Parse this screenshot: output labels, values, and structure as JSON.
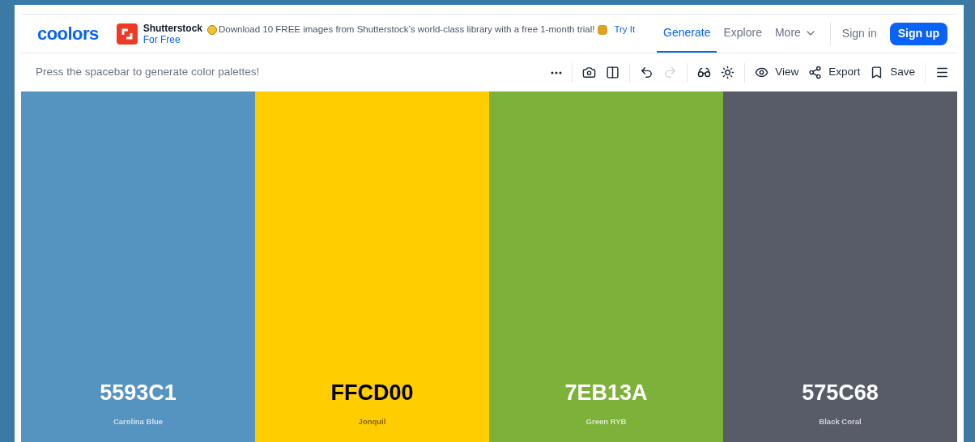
{
  "logo": "coolors",
  "ad": {
    "brand": "Shutterstock",
    "sub": "For Free",
    "message": "Download 10 FREE images from Shutterstock’s world-class library with a free 1-month trial!",
    "link": "Try It"
  },
  "nav": [
    {
      "label": "Generate",
      "selected": true
    },
    {
      "label": "Explore",
      "selected": false
    },
    {
      "label": "More",
      "selected": false
    }
  ],
  "sign_in": "Sign in",
  "sign_up": "Sign up",
  "hint": "Press the spacebar to generate color palettes!",
  "toolbar": [
    {
      "kind": "more",
      "disabled": false
    },
    {
      "kind": "camera",
      "disabled": false
    },
    {
      "kind": "panel",
      "disabled": false
    },
    {
      "kind": "undo",
      "disabled": false
    },
    {
      "kind": "redo",
      "disabled": true
    },
    {
      "kind": "glasses",
      "disabled": false
    },
    {
      "kind": "sun",
      "disabled": false
    },
    {
      "kind": "view",
      "label": "View",
      "disabled": false
    },
    {
      "kind": "export",
      "label": "Export",
      "disabled": false
    },
    {
      "kind": "save",
      "label": "Save",
      "disabled": false
    },
    {
      "kind": "menu",
      "disabled": false
    }
  ],
  "palette": [
    {
      "hex": "5593C1",
      "name": "Carolina Blue",
      "color": "#5593c1"
    },
    {
      "hex": "FFCD00",
      "name": "Jonquil",
      "color": "#ffcd00"
    },
    {
      "hex": "7EB13A",
      "name": "Green RYB",
      "color": "#7eb13a"
    },
    {
      "hex": "575C68",
      "name": "Black Coral",
      "color": "#575c68"
    }
  ]
}
